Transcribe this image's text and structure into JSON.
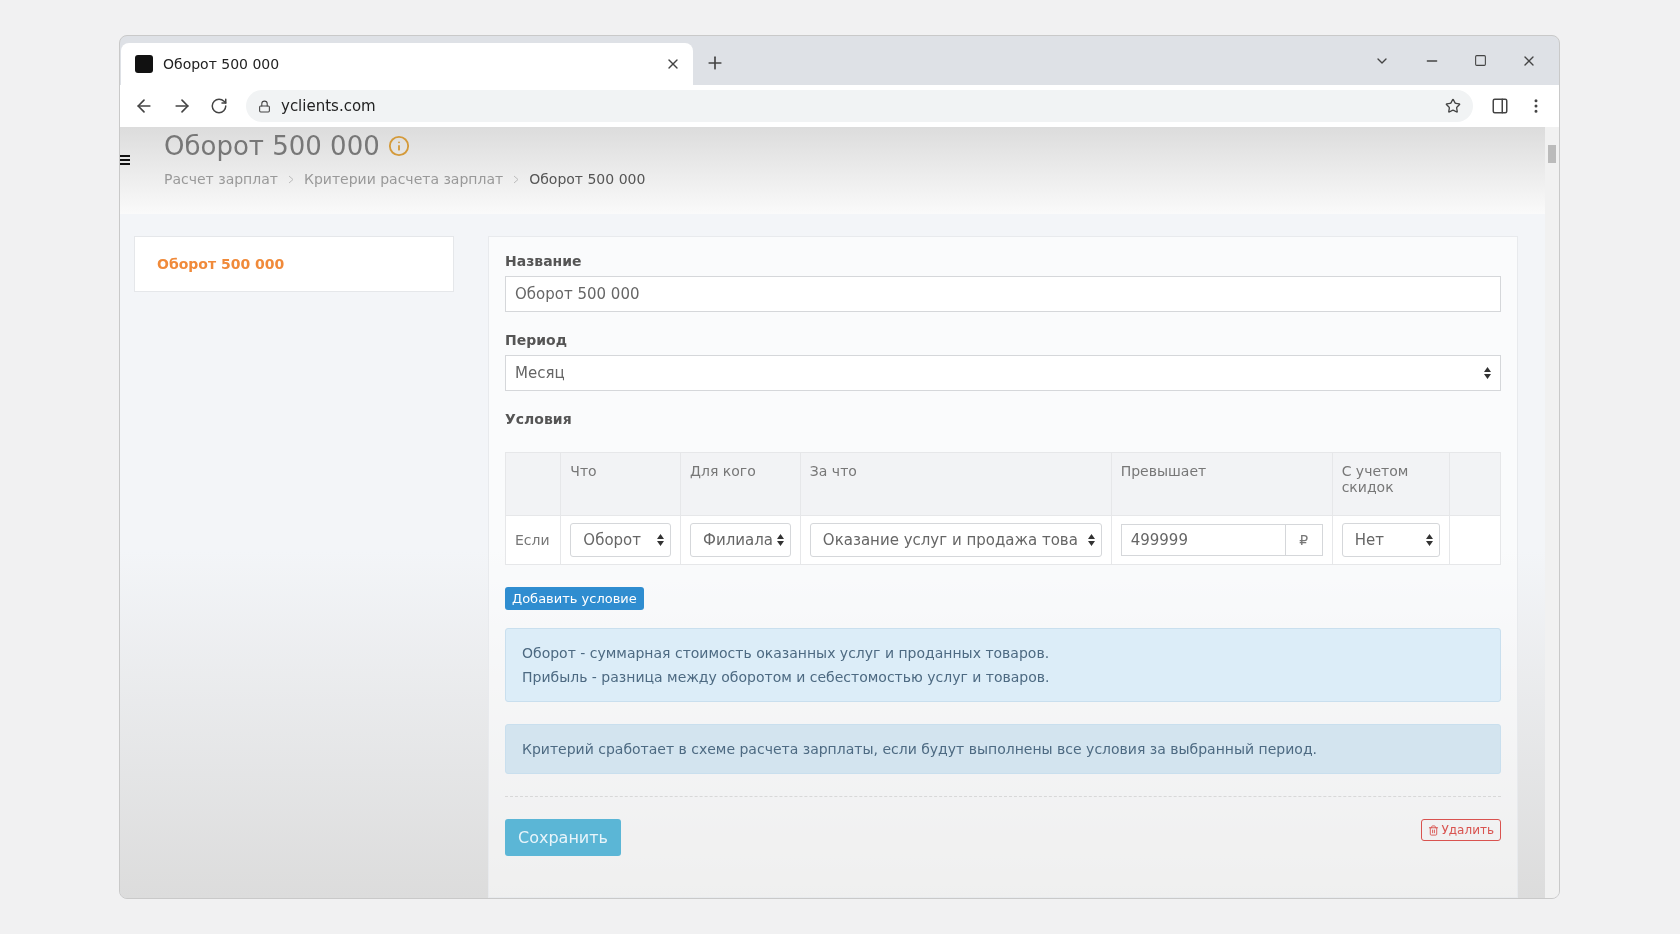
{
  "browser": {
    "tab_title": "Оборот 500 000",
    "url": "yclients.com"
  },
  "header": {
    "title": "Оборот 500 000",
    "breadcrumbs": [
      {
        "label": "Расчет зарплат",
        "current": false
      },
      {
        "label": "Критерии расчета зарплат",
        "current": false
      },
      {
        "label": "Оборот 500 000",
        "current": true
      }
    ]
  },
  "sidebar": {
    "items": [
      {
        "label": "Оборот 500 000"
      }
    ]
  },
  "form": {
    "name_label": "Название",
    "name_value": "Оборот 500 000",
    "period_label": "Период",
    "period_value": "Месяц",
    "conditions_label": "Условия"
  },
  "table": {
    "columns": [
      "",
      "Что",
      "Для кого",
      "За что",
      "Превышает",
      "С учетом скидок",
      ""
    ],
    "rows": [
      {
        "prefix": "Если",
        "what": "Оборот",
        "for_whom": "Филиала",
        "for_what": "Оказание услуг и продажа това",
        "exceeds": "499999",
        "currency": "₽",
        "discounts": "Нет"
      }
    ]
  },
  "add_button": "Добавить условие",
  "info_lines": [
    "Оборот - суммарная стоимость оказанных услуг и проданных товаров.",
    "Прибыль - разница между оборотом и себестомостью услуг и товаров."
  ],
  "note": "Критерий сработает в схеме расчета зарплаты, если будут выполнены все условия за выбранный период.",
  "save_button": "Сохранить",
  "delete_button": "Удалить"
}
